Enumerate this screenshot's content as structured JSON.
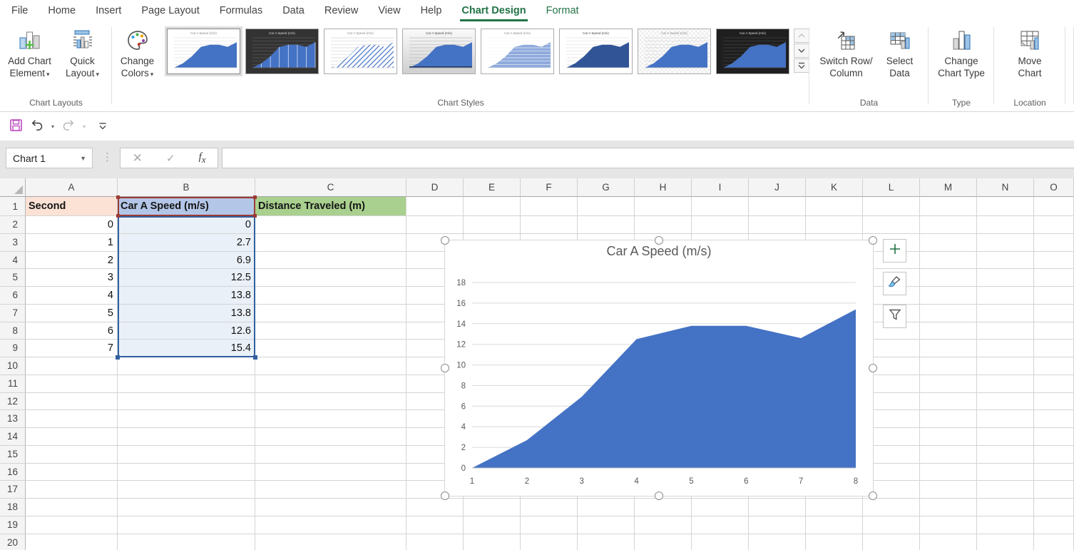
{
  "tabs": {
    "items": [
      {
        "label": "File"
      },
      {
        "label": "Home"
      },
      {
        "label": "Insert"
      },
      {
        "label": "Page Layout"
      },
      {
        "label": "Formulas"
      },
      {
        "label": "Data"
      },
      {
        "label": "Review"
      },
      {
        "label": "View"
      },
      {
        "label": "Help"
      },
      {
        "label": "Chart Design",
        "active": true
      },
      {
        "label": "Format",
        "contextual": true
      }
    ]
  },
  "ribbon": {
    "groups": [
      {
        "label": "Chart Layouts"
      },
      {
        "label": "Chart Styles"
      },
      {
        "label": "Data"
      },
      {
        "label": "Type"
      },
      {
        "label": "Location"
      }
    ],
    "buttons": {
      "add_chart_element": {
        "line1": "Add Chart",
        "line2": "Element",
        "dropdown": true
      },
      "quick_layout": {
        "line1": "Quick",
        "line2": "Layout",
        "dropdown": true
      },
      "change_colors": {
        "line1": "Change",
        "line2": "Colors",
        "dropdown": true
      },
      "switch_row_column": {
        "line1": "Switch Row/",
        "line2": "Column"
      },
      "select_data": {
        "line1": "Select",
        "line2": "Data"
      },
      "change_chart_type": {
        "line1": "Change",
        "line2": "Chart Type"
      },
      "move_chart": {
        "line1": "Move",
        "line2": "Chart"
      }
    },
    "style_gallery": {
      "selected_index": 0,
      "styles": [
        {
          "name": "Style 1",
          "theme": "light"
        },
        {
          "name": "Style 2",
          "theme": "dark-grid"
        },
        {
          "name": "Style 3",
          "theme": "hatched"
        },
        {
          "name": "Style 4",
          "theme": "gray"
        },
        {
          "name": "Style 5",
          "theme": "soft"
        },
        {
          "name": "Style 6",
          "theme": "deep-blue"
        },
        {
          "name": "Style 7",
          "theme": "texture"
        },
        {
          "name": "Style 8",
          "theme": "black"
        }
      ]
    }
  },
  "quick_access": {
    "icons": [
      "save-icon",
      "undo-icon",
      "redo-icon",
      "customize-quick-access-icon"
    ]
  },
  "formula_bar": {
    "name_box": "Chart 1",
    "value": ""
  },
  "sheet": {
    "columns": [
      "A",
      "B",
      "C",
      "D",
      "E",
      "F",
      "G",
      "H",
      "I",
      "J",
      "K",
      "L",
      "M",
      "N",
      "O"
    ],
    "row_count": 20,
    "header_fills": {
      "A1": "#FBE2D5",
      "B1": "#B4C6E7",
      "C1": "#A9D08E"
    },
    "cells": {
      "A1": "Second",
      "B1": "Car A Speed (m/s)",
      "C1": "Distance Traveled (m)",
      "A2": "0",
      "B2": "0",
      "A3": "1",
      "B3": "2.7",
      "A4": "2",
      "B4": "6.9",
      "A5": "3",
      "B5": "12.5",
      "A6": "4",
      "B6": "13.8",
      "A7": "5",
      "B7": "13.8",
      "A8": "6",
      "B8": "12.6",
      "A9": "7",
      "B9": "15.4"
    },
    "selection": {
      "series_cell": "B1",
      "value_range": "B2:B9"
    }
  },
  "chart_data": {
    "type": "area",
    "title": "Car A Speed (m/s)",
    "categories": [
      1,
      2,
      3,
      4,
      5,
      6,
      7,
      8
    ],
    "values": [
      0,
      2.7,
      6.9,
      12.5,
      13.8,
      13.8,
      12.6,
      15.4
    ],
    "ylim": [
      0,
      18
    ],
    "ytick_step": 2,
    "xlabel": "",
    "ylabel": "",
    "legend": "none",
    "grid": true,
    "fill_color": "#4472C4",
    "axis_text_color": "#595959",
    "gridline_color": "#D9D9D9"
  },
  "chart_side_buttons": [
    {
      "name": "Chart Elements"
    },
    {
      "name": "Chart Styles"
    },
    {
      "name": "Chart Filters"
    }
  ],
  "colors": {
    "accent": "#4472C4",
    "excel_green": "#217346",
    "selection_red": "#9C3B35",
    "selection_blue": "#31609F"
  }
}
